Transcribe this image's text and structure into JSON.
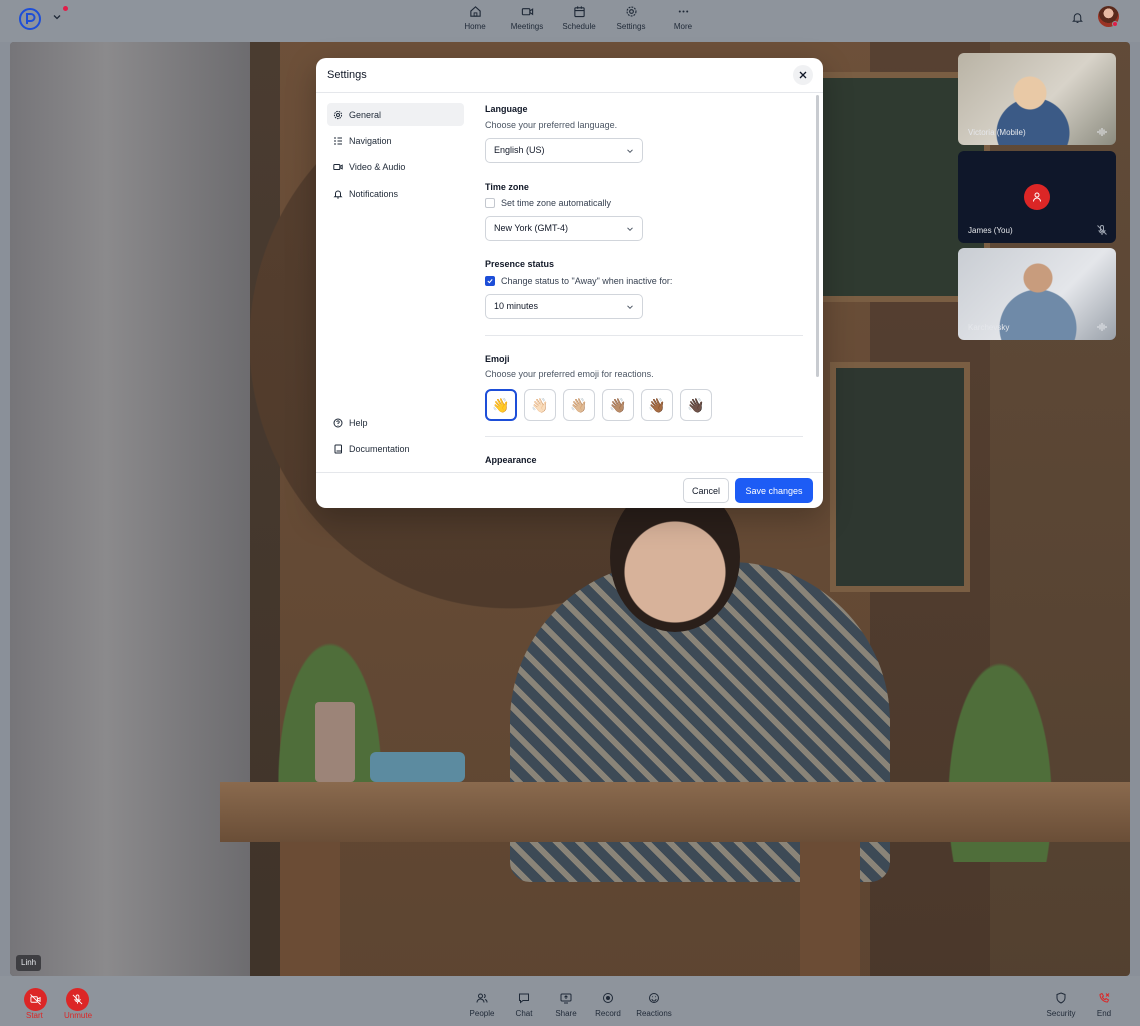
{
  "topnav": {
    "items": [
      {
        "label": "Home",
        "icon": "home-icon"
      },
      {
        "label": "Meetings",
        "icon": "video-icon"
      },
      {
        "label": "Schedule",
        "icon": "calendar-icon"
      },
      {
        "label": "Settings",
        "icon": "gear-icon"
      },
      {
        "label": "More",
        "icon": "more-icon"
      }
    ]
  },
  "stage": {
    "speaker_name": "Linh"
  },
  "participants": [
    {
      "name": "Victoria (Mobile)",
      "status_icon": "audio-wave-icon"
    },
    {
      "name": "James (You)",
      "status_icon": "mic-off-icon"
    },
    {
      "name": "Karchevsky",
      "status_icon": "audio-wave-icon"
    }
  ],
  "bottombar": {
    "start_label": "Start",
    "unmute_label": "Unmute",
    "items": [
      {
        "label": "People",
        "icon": "people-icon"
      },
      {
        "label": "Chat",
        "icon": "chat-icon"
      },
      {
        "label": "Share",
        "icon": "share-screen-icon"
      },
      {
        "label": "Record",
        "icon": "record-icon"
      },
      {
        "label": "Reactions",
        "icon": "smile-icon"
      }
    ],
    "security_label": "Security",
    "end_label": "End"
  },
  "dialog": {
    "title": "Settings",
    "sidebar": {
      "items": [
        {
          "label": "General",
          "icon": "gear-icon",
          "active": true
        },
        {
          "label": "Navigation",
          "icon": "list-icon",
          "active": false
        },
        {
          "label": "Video & Audio",
          "icon": "video-icon",
          "active": false
        },
        {
          "label": "Notifications",
          "icon": "bell-icon",
          "active": false
        }
      ],
      "footer": [
        {
          "label": "Help",
          "icon": "help-icon"
        },
        {
          "label": "Documentation",
          "icon": "book-icon"
        }
      ]
    },
    "language": {
      "title": "Language",
      "description": "Choose your preferred language.",
      "value": "English (US)"
    },
    "timezone": {
      "title": "Time zone",
      "auto_label": "Set time zone automatically",
      "auto_checked": false,
      "value": "New York (GMT-4)"
    },
    "presence": {
      "title": "Presence status",
      "away_label": "Change status to \"Away\" when inactive for:",
      "away_checked": true,
      "value": "10 minutes"
    },
    "emoji": {
      "title": "Emoji",
      "description": "Choose your preferred emoji for reactions.",
      "options": [
        "👋",
        "👋🏻",
        "👋🏼",
        "👋🏽",
        "👋🏾",
        "👋🏿"
      ],
      "selected_index": 0
    },
    "appearance": {
      "title": "Appearance"
    },
    "cancel_label": "Cancel",
    "save_label": "Save changes"
  },
  "colors": {
    "accent": "#1d5cf5",
    "danger": "#dc2626"
  }
}
